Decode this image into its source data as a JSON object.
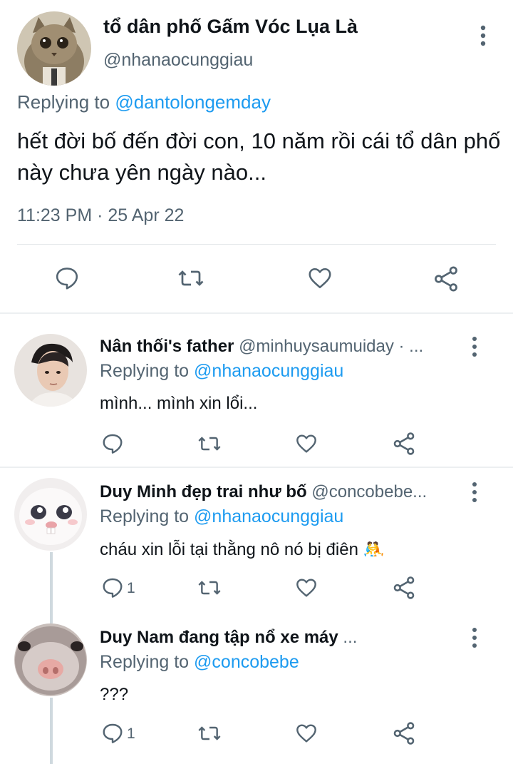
{
  "main_tweet": {
    "display_name": "tổ dân phố Gấm Vóc Lụa Là",
    "handle": "@nhanaocunggiau",
    "replying_prefix": "Replying to",
    "replying_to": "@dantolongemday",
    "text": "hết đời bố đến đời con, 10 năm rồi cái tổ dân phố này chưa yên ngày nào...",
    "timestamp": "11:23 PM · 25 Apr 22"
  },
  "replies": [
    {
      "display_name": "Nân thối's father",
      "handle": "@minhuysaumuiday · ...",
      "replying_prefix": "Replying to",
      "replying_to": "@nhanaocunggiau",
      "text": "mình... mình xin lổi...",
      "reply_count": ""
    },
    {
      "display_name": "Duy Minh đẹp trai như bố",
      "handle": "@concobebe...",
      "replying_prefix": "Replying to",
      "replying_to": "@nhanaocunggiau",
      "text": "cháu xin lỗi tại thằng nô nó bị điên 🤼",
      "reply_count": "1"
    },
    {
      "display_name": "Duy Nam đang tập nổ xe máy",
      "handle": "...",
      "replying_prefix": "Replying to",
      "replying_to": "@concobebe",
      "text": "???",
      "reply_count": "1"
    }
  ],
  "icons": {
    "reply": "reply-icon",
    "retweet": "retweet-icon",
    "like": "heart-icon",
    "share": "share-icon",
    "more": "more-vertical-icon"
  },
  "colors": {
    "text": "#0f1419",
    "secondary": "#536471",
    "link": "#1d9bf0",
    "divider": "#eceff1"
  }
}
